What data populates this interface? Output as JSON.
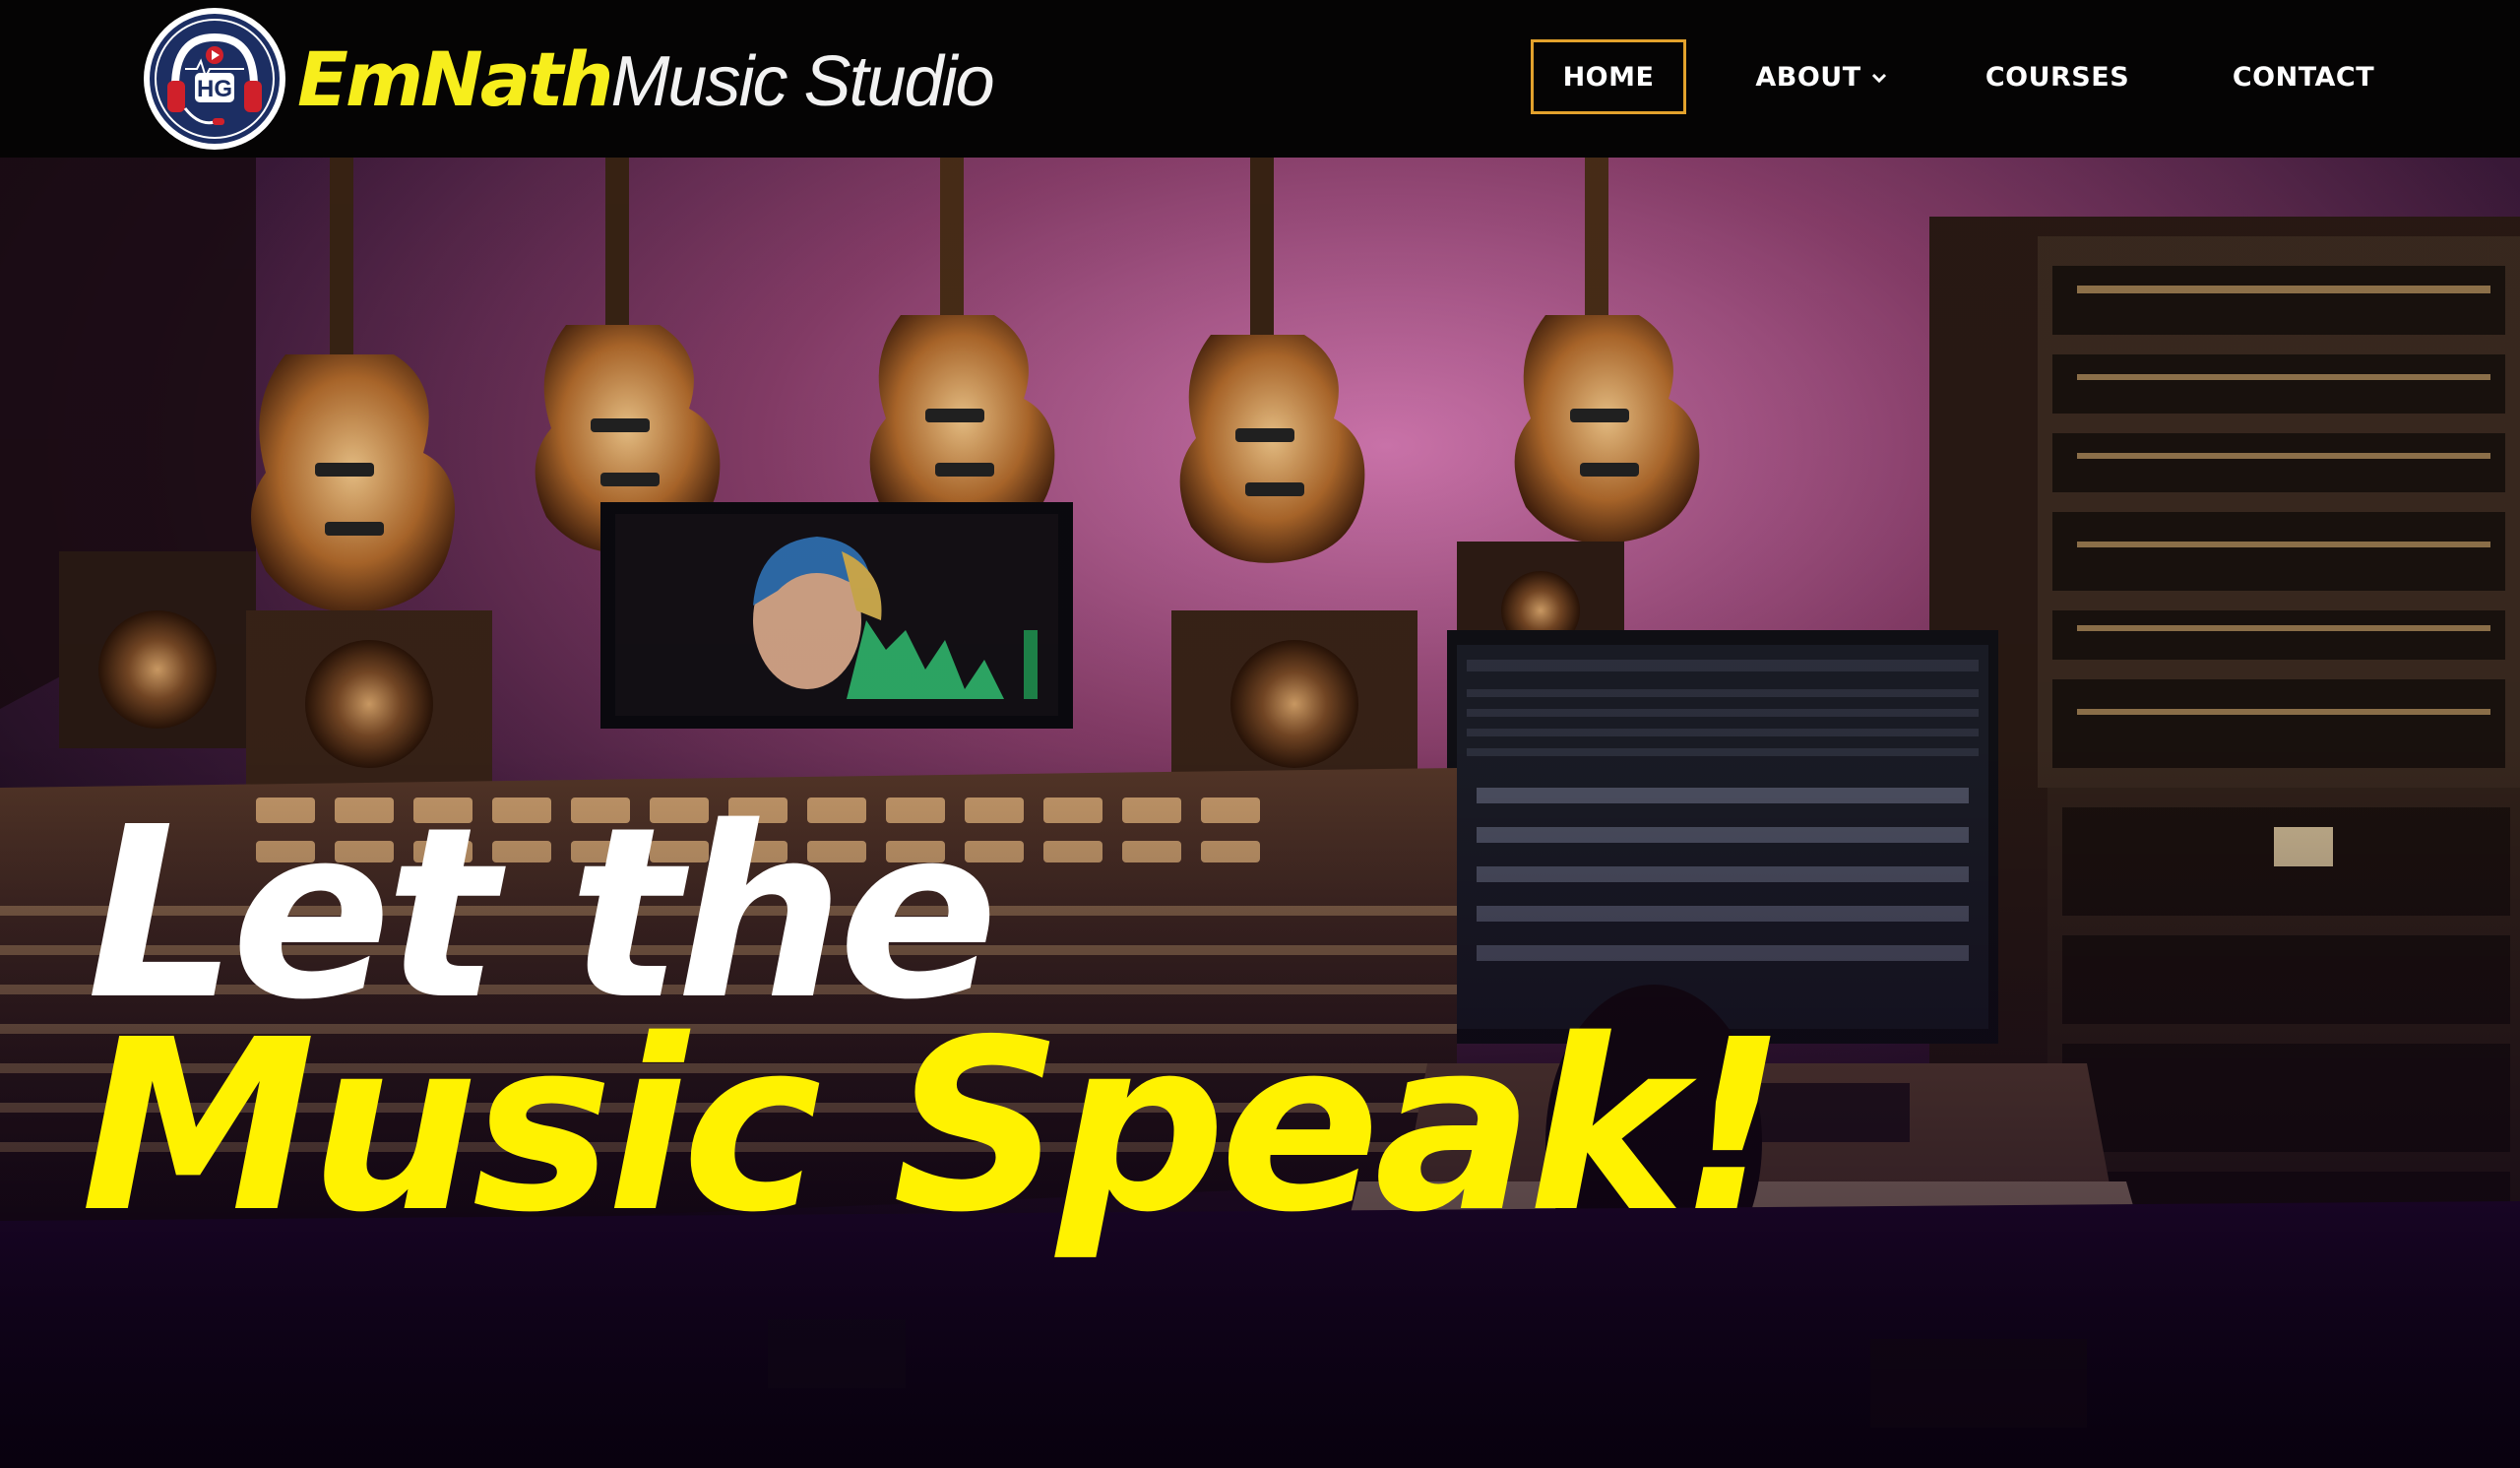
{
  "brand": {
    "badge_text": "HG",
    "name_primary": "EmNath",
    "name_secondary": "Music Studio"
  },
  "nav": {
    "items": [
      {
        "label": "HOME",
        "active": true
      },
      {
        "label": "ABOUT",
        "has_dropdown": true
      },
      {
        "label": "COURSES"
      },
      {
        "label": "CONTACT"
      }
    ]
  },
  "hero": {
    "headline_line1": "Let the",
    "headline_line2": "Music Speak!"
  },
  "colors": {
    "nav_bg": "#050404",
    "brand_yellow": "#f7ee1c",
    "headline_yellow": "#fff200",
    "active_border": "#e3a22c"
  }
}
